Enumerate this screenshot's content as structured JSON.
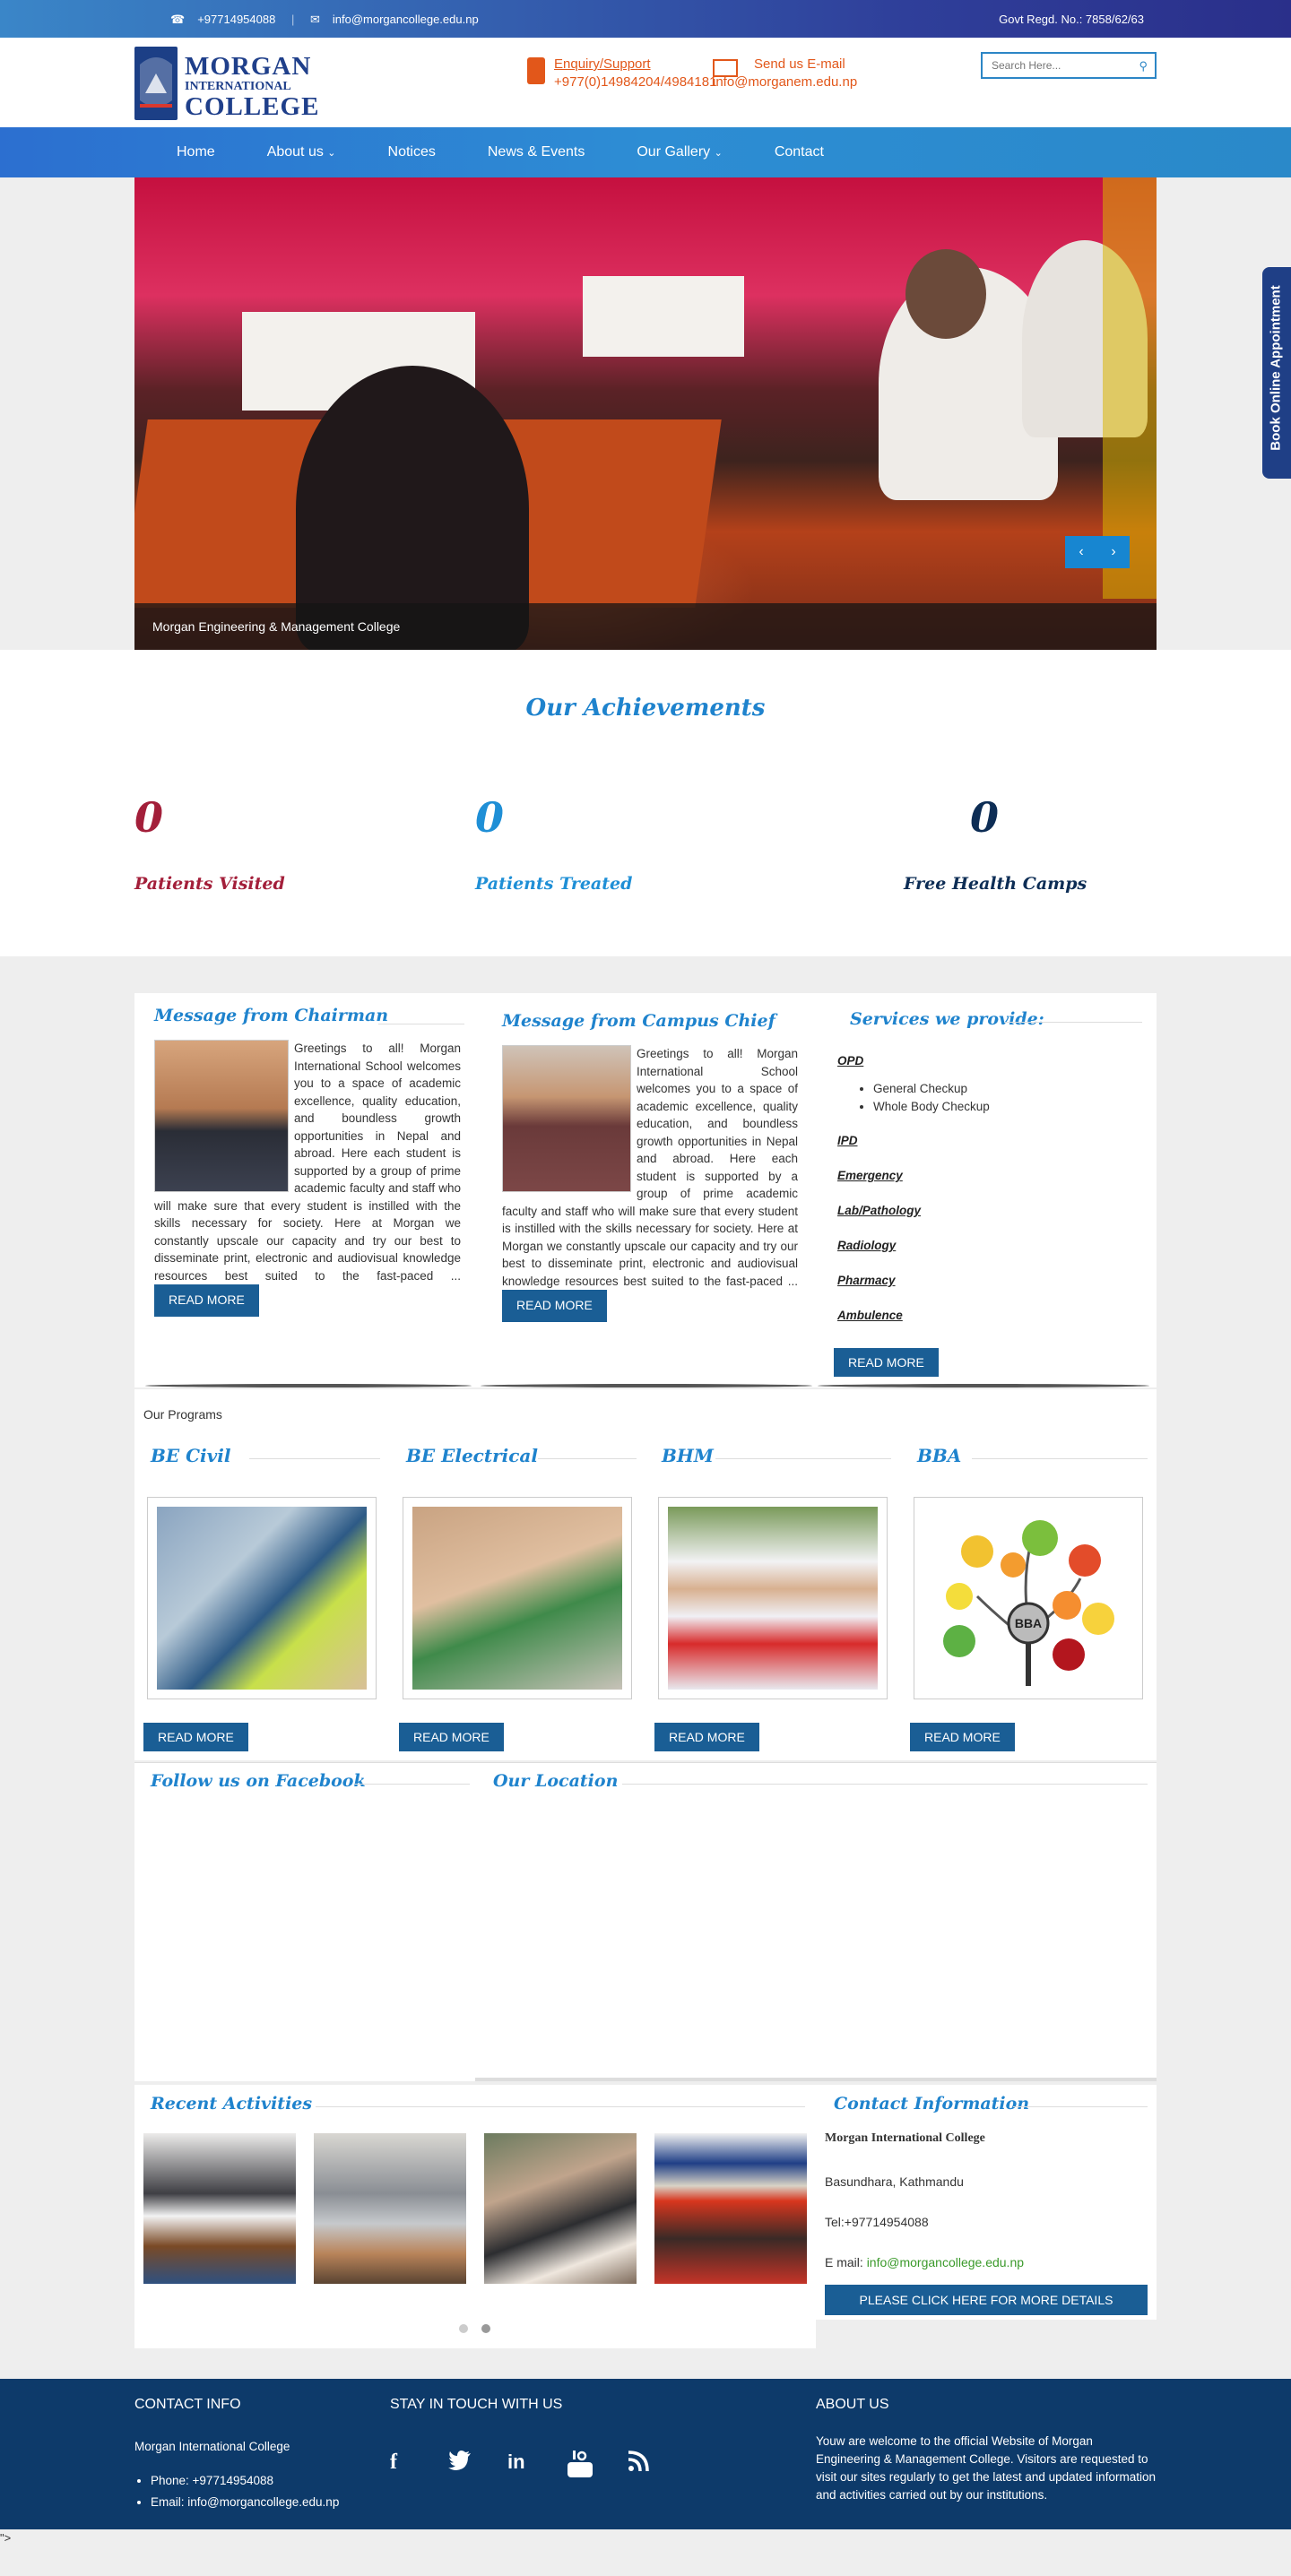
{
  "topbar": {
    "phone": "+97714954088",
    "email": "info@morgancollege.edu.np",
    "regd": "Govt Regd. No.: 7858/62/63"
  },
  "header": {
    "logo_line1": "MORGAN",
    "logo_line2": "INTERNATIONAL",
    "logo_line3": "COLLEGE",
    "enquiry_label": "Enquiry/Support",
    "enquiry_phone": "+977(0)14984204/4984181",
    "email_label": "Send us E-mail",
    "email_value": "info@morganem.edu.np",
    "search_placeholder": "Search Here..."
  },
  "nav": {
    "items": [
      "Home",
      "About us",
      "Notices",
      "News & Events",
      "Our Gallery",
      "Contact"
    ]
  },
  "slider": {
    "caption": "Morgan Engineering & Management College",
    "prev": "‹",
    "next": "›"
  },
  "book_label": "Book Online Appointment",
  "achievements": {
    "title": "Our Achievements",
    "items": [
      {
        "value": "0",
        "label": "Patients Visited",
        "color": "#a31f3a"
      },
      {
        "value": "0",
        "label": "Patients Treated",
        "color": "#1f8fd6"
      },
      {
        "value": "0",
        "label": "Free Health Camps",
        "color": "#0d2d55"
      }
    ]
  },
  "chairman": {
    "title": "Message from Chairman",
    "text": "Greetings to all! Morgan International School welcomes you to a space of academic excellence, quality education, and boundless growth opportunities in Nepal and abroad. Here each student is supported by a group of prime academic faculty and staff who will make sure that every student is instilled with the skills necessary for society. Here at Morgan we constantly upscale our capacity and try our best to disseminate print, electronic and audiovisual knowledge resources best suited to the fast-paced ...",
    "button": "READ MORE"
  },
  "campus_chief": {
    "title": "Message from Campus Chief",
    "text": "Greetings to all! Morgan International School welcomes you to a space of academic excellence, quality education, and boundless growth opportunities in Nepal and abroad. Here each student is supported by a group of prime academic faculty and staff who will make sure that every student is instilled with the skills necessary for society. Here at Morgan we constantly upscale our capacity and try our best to disseminate print, electronic and audiovisual knowledge resources best suited to the fast-paced ...",
    "button": "READ MORE"
  },
  "services": {
    "title": "Services we provide:",
    "opd": "OPD",
    "opd_items": [
      "General Checkup",
      "Whole Body Checkup"
    ],
    "items": [
      "IPD",
      "Emergency",
      "Lab/Pathology",
      "Radiology",
      "Pharmacy",
      "Ambulence"
    ],
    "button": "READ MORE"
  },
  "programs": {
    "heading": "Our Programs",
    "items": [
      {
        "title": "BE Civil",
        "button": "READ MORE"
      },
      {
        "title": "BE Electrical",
        "button": "READ MORE"
      },
      {
        "title": "BHM",
        "button": "READ MORE"
      },
      {
        "title": "BBA",
        "button": "READ MORE"
      }
    ],
    "bba_center": "BBA"
  },
  "facebook_title": "Follow us on Facebook",
  "location_title": "Our Location",
  "recent_title": "Recent Activities",
  "contact_info": {
    "title": "Contact Information",
    "name": "Morgan International College",
    "address": "Basundhara, Kathmandu",
    "tel": "Tel:+97714954088",
    "email_label": "E mail: ",
    "email": "info@morgancollege.edu.np",
    "button": "PLEASE CLICK HERE FOR MORE DETAILS"
  },
  "footer": {
    "contact_heading": "CONTACT INFO",
    "college": "Morgan International College",
    "phone": "Phone:  +97714954088",
    "email": "Email:  info@morgancollege.edu.np",
    "touch_heading": "STAY IN TOUCH WITH US",
    "about_heading": "ABOUT US",
    "about_text": "Youw are welcome to the official Website of Morgan Engineering & Management College. Visitors are requested to visit our sites regularly to get the latest and updated information and activities carried out by our institutions."
  },
  "stray_text": "\">"
}
